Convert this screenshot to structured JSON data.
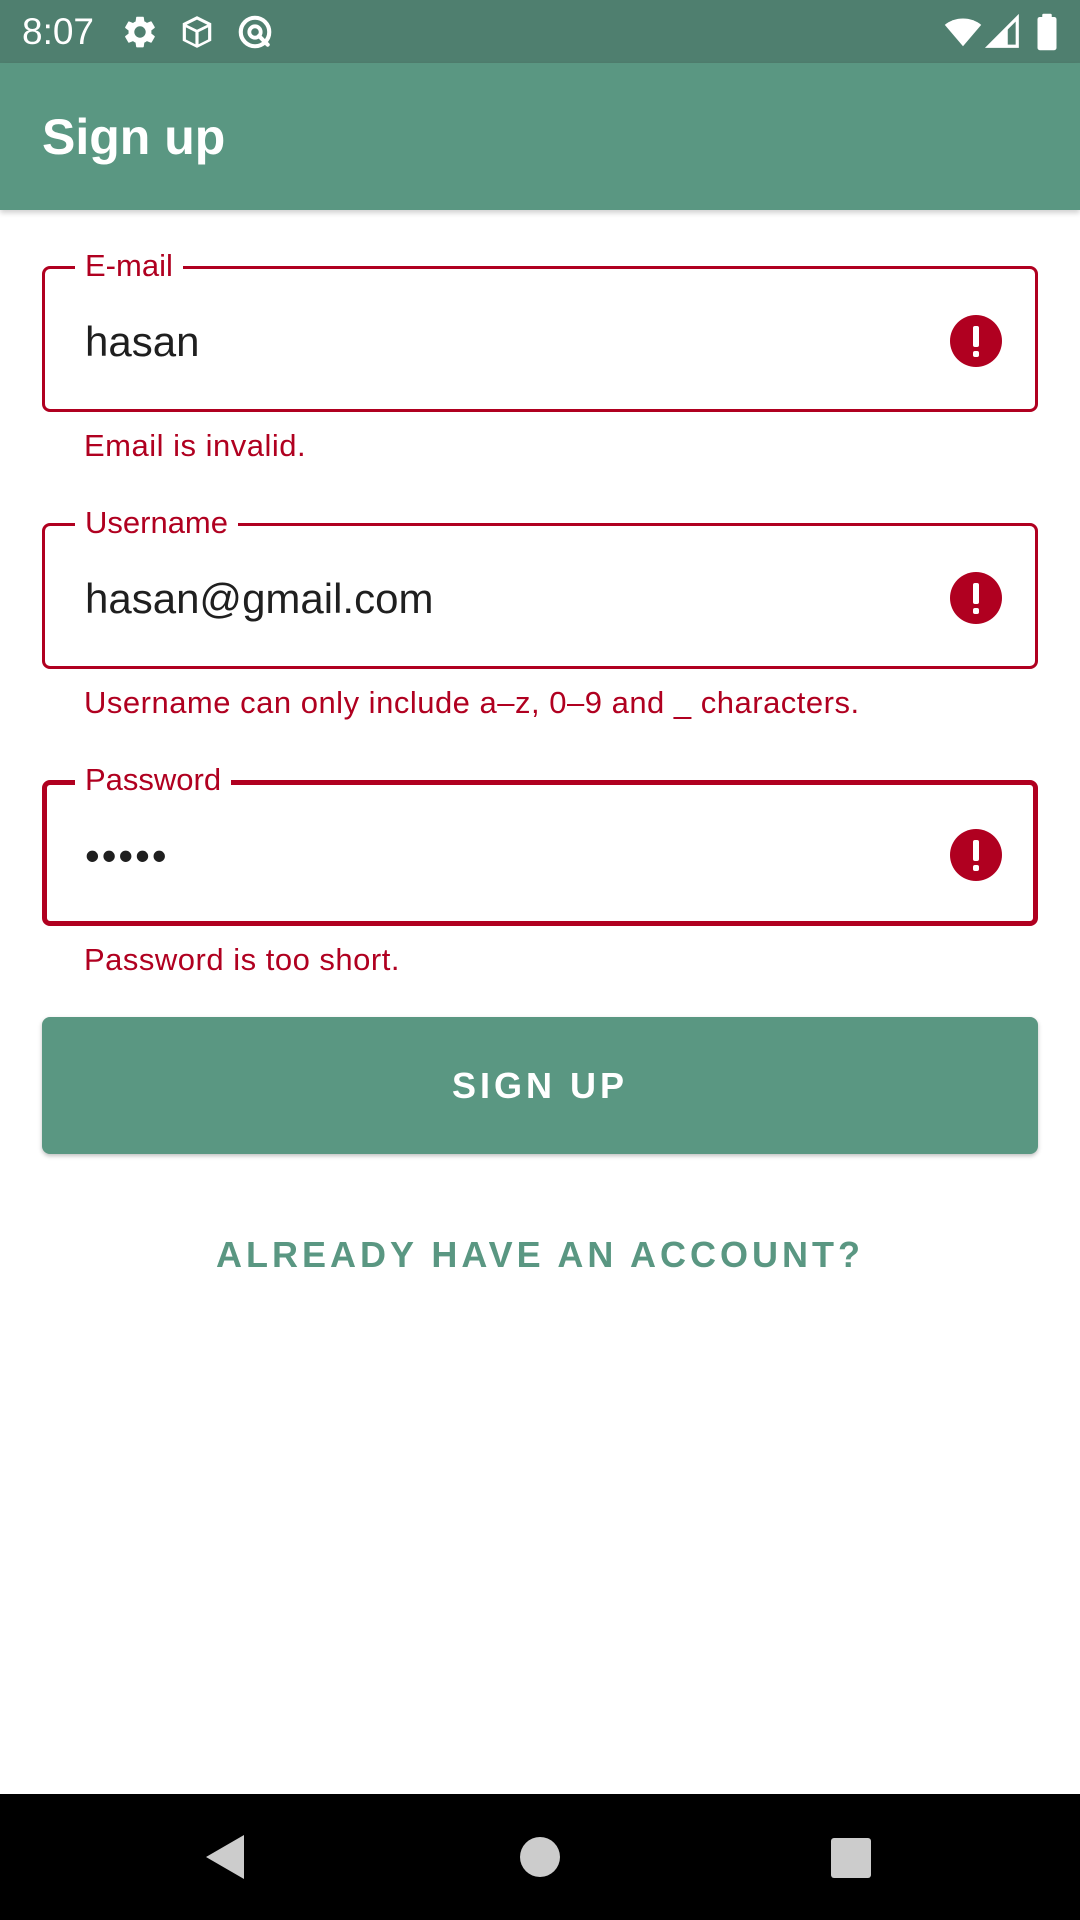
{
  "status_bar": {
    "time": "8:07",
    "left_icons": [
      "gear-icon",
      "package-icon",
      "at-sign-icon"
    ],
    "right_icons": [
      "wifi-icon",
      "cell-signal-icon",
      "battery-icon"
    ]
  },
  "app_bar": {
    "title": "Sign up"
  },
  "form": {
    "email": {
      "label": "E-mail",
      "value": "hasan",
      "error": "Email is invalid."
    },
    "username": {
      "label": "Username",
      "value": "hasan@gmail.com",
      "error": "Username can only include a–z, 0–9 and _ characters."
    },
    "password": {
      "label": "Password",
      "value": "•••••",
      "error": "Password is too short."
    }
  },
  "actions": {
    "signup_label": "SIGN UP",
    "login_link_label": "ALREADY HAVE AN ACCOUNT?"
  },
  "nav_bar": {
    "buttons": [
      "back-icon",
      "home-icon",
      "recents-icon"
    ]
  },
  "colors": {
    "primary": "#5a9782",
    "status_bar": "#4f7f6f",
    "error": "#b00020"
  }
}
